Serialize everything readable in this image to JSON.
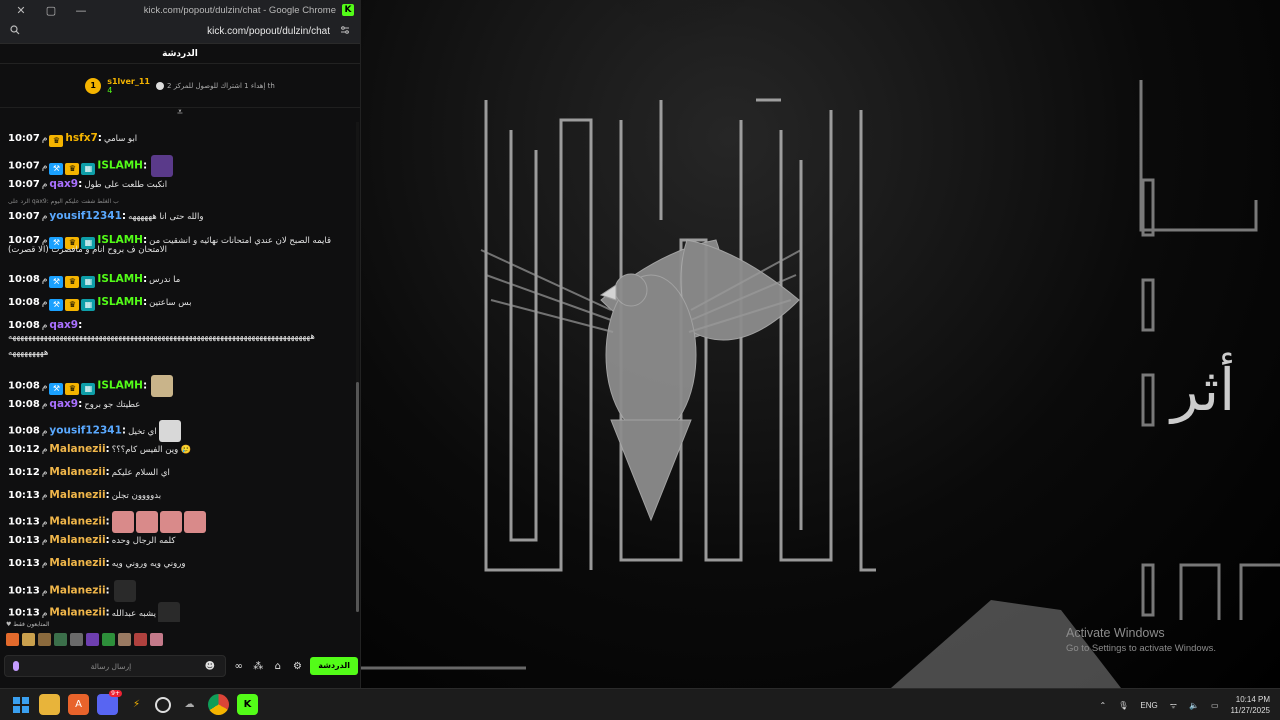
{
  "window": {
    "title": "kick.com/popout/dulzin/chat - Google Chrome",
    "url": "kick.com/popout/dulzin/chat",
    "close_icon": "✕",
    "restore_icon": "▢",
    "min_icon": "—",
    "brand_logo": "K"
  },
  "chat": {
    "header": "الدردشة",
    "pinned": {
      "rank": "1",
      "username": "s1lver_11",
      "count": "4",
      "description": "إهداء 1 اشتراك للوصول للمركز 2 th"
    },
    "collapse_icon": "⩡",
    "messages": [
      {
        "time": "10:07",
        "ampm": "م",
        "user": "hsfx7",
        "color": "#f5b400",
        "badges": [
          "crown"
        ],
        "text": "ابو سامي"
      },
      {
        "time": "10:07",
        "ampm": "م",
        "user": "ISLAMH",
        "color": "#53fc18",
        "badges": [
          "mod",
          "crown",
          "sub"
        ],
        "text": "",
        "avatar": "#5a3a8a"
      },
      {
        "time": "10:07",
        "ampm": "م",
        "user": "qax9",
        "color": "#a970ff",
        "badges": [],
        "text": "انكبت طلعت على طول"
      },
      {
        "time": "10:07",
        "ampm": "م",
        "user": "yousif12341",
        "color": "#5aa9ff",
        "badges": [],
        "text": "والله حتى انا ههههههه"
      },
      {
        "time": "10:07",
        "ampm": "م",
        "user": "ISLAMH",
        "color": "#53fc18",
        "badges": [
          "mod",
          "crown",
          "sub"
        ],
        "text": "قايمه الصبح لان عندي امتحانات نهائيه و انشقيت من"
      },
      {
        "time": "10:08",
        "ampm": "م",
        "user": "ISLAMH",
        "color": "#53fc18",
        "badges": [
          "mod",
          "crown",
          "sub"
        ],
        "text": "ما ندرس"
      },
      {
        "time": "10:08",
        "ampm": "م",
        "user": "ISLAMH",
        "color": "#53fc18",
        "badges": [
          "mod",
          "crown",
          "sub"
        ],
        "text": "بس ساعتين"
      },
      {
        "time": "10:08",
        "ampm": "م",
        "user": "qax9",
        "color": "#a970ff",
        "badges": [],
        "text": ""
      },
      {
        "time": "10:08",
        "ampm": "م",
        "user": "ISLAMH",
        "color": "#53fc18",
        "badges": [
          "mod",
          "crown",
          "sub"
        ],
        "text": "",
        "avatar": "#c9b48a"
      },
      {
        "time": "10:08",
        "ampm": "م",
        "user": "qax9",
        "color": "#a970ff",
        "badges": [],
        "text": "عطيتك جو بروح"
      },
      {
        "time": "10:08",
        "ampm": "م",
        "user": "yousif12341",
        "color": "#5aa9ff",
        "badges": [],
        "text": "اي تخيل",
        "avatar": "#d8d8d8"
      },
      {
        "time": "10:12",
        "ampm": "م",
        "user": "Malanezii",
        "color": "#f0b64a",
        "badges": [],
        "text": "وين الفيس كام؟؟؟ 🥲"
      },
      {
        "time": "10:12",
        "ampm": "م",
        "user": "Malanezii",
        "color": "#f0b64a",
        "badges": [],
        "text": "اي السلام عليكم"
      },
      {
        "time": "10:13",
        "ampm": "م",
        "user": "Malanezii",
        "color": "#f0b64a",
        "badges": [],
        "text": "بدوووون تجلن"
      },
      {
        "time": "10:13",
        "ampm": "م",
        "user": "Malanezii",
        "color": "#f0b64a",
        "badges": [],
        "text": "",
        "emotes": 4
      },
      {
        "time": "10:13",
        "ampm": "م",
        "user": "Malanezii",
        "color": "#f0b64a",
        "badges": [],
        "text": "كلمه الرجال وحده"
      },
      {
        "time": "10:13",
        "ampm": "م",
        "user": "Malanezii",
        "color": "#f0b64a",
        "badges": [],
        "text": "وروني ويه وروني ويه"
      },
      {
        "time": "10:13",
        "ampm": "م",
        "user": "Malanezii",
        "color": "#f0b64a",
        "badges": [],
        "text": "",
        "avatar": "#2a2a2a"
      },
      {
        "time": "10:13",
        "ampm": "م",
        "user": "Malanezii",
        "color": "#f0b64a",
        "badges": [],
        "text": "يشبه عبدالله",
        "avatar": "#2a2a2a"
      }
    ],
    "wrap_line_1": "الامتحان ف بروح انام و مافصرت (الا قصرت)",
    "qax_line_1": "هههههههههههههههههههههههههههههههههههههههههههههههههههههههههههههههههههههههههههههه",
    "qax_line_2": "هههههههههه",
    "reply_note": "الرد على qax9: ب الغلط شفت عليكم اليوم",
    "subscribers_label": "المتابعون فقط",
    "input_placeholder": "إرسال رسالة",
    "send_label": "الدردشة"
  },
  "desktop": {
    "activate_title": "Activate Windows",
    "activate_sub": "Go to Settings to activate Windows."
  },
  "taskbar": {
    "language": "ENG",
    "time": "10:14 PM",
    "date": "11/27/2025",
    "discord_badge": "9+"
  }
}
